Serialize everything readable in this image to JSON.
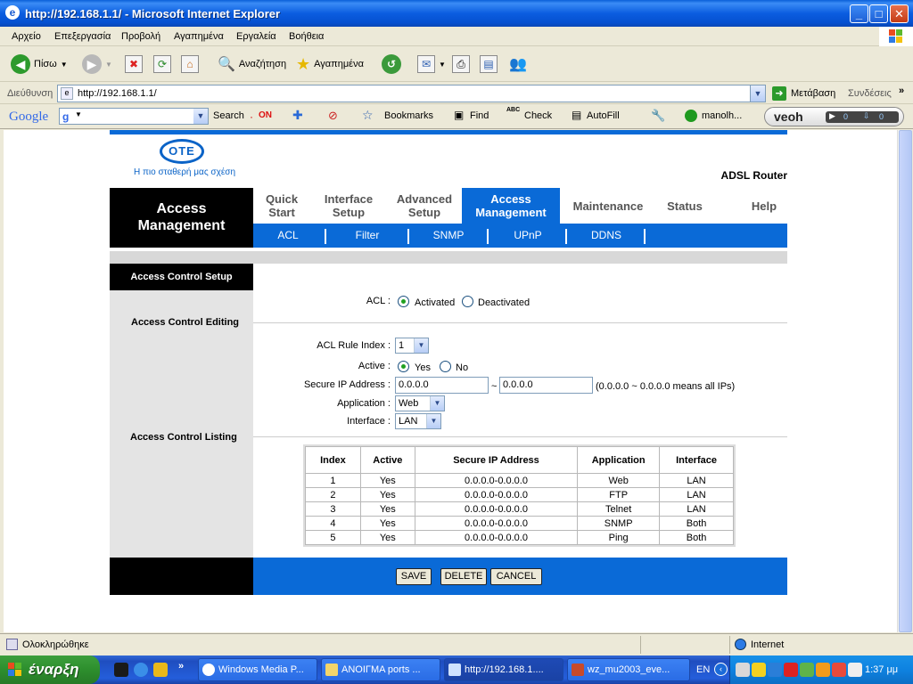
{
  "window": {
    "title": "http://192.168.1.1/ - Microsoft Internet Explorer"
  },
  "menu": [
    "Αρχείο",
    "Επεξεργασία",
    "Προβολή",
    "Αγαπημένα",
    "Εργαλεία",
    "Βοήθεια"
  ],
  "toolbar": {
    "back": "Πίσω",
    "search": "Αναζήτηση",
    "favorites": "Αγαπημένα"
  },
  "address": {
    "label": "Διεύθυνση",
    "url": "http://192.168.1.1/",
    "go": "Μετάβαση",
    "links": "Συνδέσεις"
  },
  "google_bar": {
    "logo": "Google",
    "g_letter": "g",
    "search": "Search",
    "on": "ON",
    "bookmarks": "Bookmarks",
    "find": "Find",
    "check_abc": "ABC",
    "check": "Check",
    "autofill": "AutoFill",
    "user": "manolh...",
    "veoh": "veoh",
    "veoh_count1": "0",
    "veoh_count2": "0"
  },
  "router": {
    "logo": "OTE",
    "tagline": "Η πιο σταθερή μας σχέση",
    "product": "ADSL Router",
    "section_title_line1": "Access",
    "section_title_line2": "Management",
    "nav": [
      {
        "l1": "Quick",
        "l2": "Start"
      },
      {
        "l1": "Interface",
        "l2": "Setup"
      },
      {
        "l1": "Advanced",
        "l2": "Setup"
      },
      {
        "l1": "Access",
        "l2": "Management"
      },
      {
        "l1": "Maintenance",
        "l2": ""
      },
      {
        "l1": "Status",
        "l2": ""
      },
      {
        "l1": "Help",
        "l2": ""
      }
    ],
    "subnav": [
      "ACL",
      "Filter",
      "SNMP",
      "UPnP",
      "DDNS"
    ],
    "left": {
      "setup": "Access Control Setup",
      "editing": "Access Control Editing",
      "listing": "Access Control Listing"
    },
    "form": {
      "acl_label": "ACL :",
      "activated": "Activated",
      "deactivated": "Deactivated",
      "rule_index_label": "ACL Rule Index :",
      "rule_index_value": "1",
      "active_label": "Active :",
      "yes": "Yes",
      "no": "No",
      "secure_ip_label": "Secure IP Address :",
      "ip_start": "0.0.0.0",
      "tilde": "~",
      "ip_end": "0.0.0.0",
      "ip_hint": "(0.0.0.0 ~ 0.0.0.0 means all IPs)",
      "application_label": "Application :",
      "application_value": "Web",
      "interface_label": "Interface :",
      "interface_value": "LAN"
    },
    "table": {
      "headers": [
        "Index",
        "Active",
        "Secure IP Address",
        "Application",
        "Interface"
      ],
      "rows": [
        [
          "1",
          "Yes",
          "0.0.0.0-0.0.0.0",
          "Web",
          "LAN"
        ],
        [
          "2",
          "Yes",
          "0.0.0.0-0.0.0.0",
          "FTP",
          "LAN"
        ],
        [
          "3",
          "Yes",
          "0.0.0.0-0.0.0.0",
          "Telnet",
          "LAN"
        ],
        [
          "4",
          "Yes",
          "0.0.0.0-0.0.0.0",
          "SNMP",
          "Both"
        ],
        [
          "5",
          "Yes",
          "0.0.0.0-0.0.0.0",
          "Ping",
          "Both"
        ]
      ]
    },
    "buttons": {
      "save": "SAVE",
      "delete": "DELETE",
      "cancel": "CANCEL"
    }
  },
  "status": {
    "text": "Ολοκληρώθηκε",
    "zone": "Internet"
  },
  "taskbar": {
    "start": "έναρξη",
    "tasks": [
      "Windows Media P...",
      "ΑΝΟΙΓΜΑ ports ...",
      "http://192.168.1....",
      "wz_mu2003_eve..."
    ],
    "lang": "EN",
    "clock": "1:37 μμ"
  }
}
